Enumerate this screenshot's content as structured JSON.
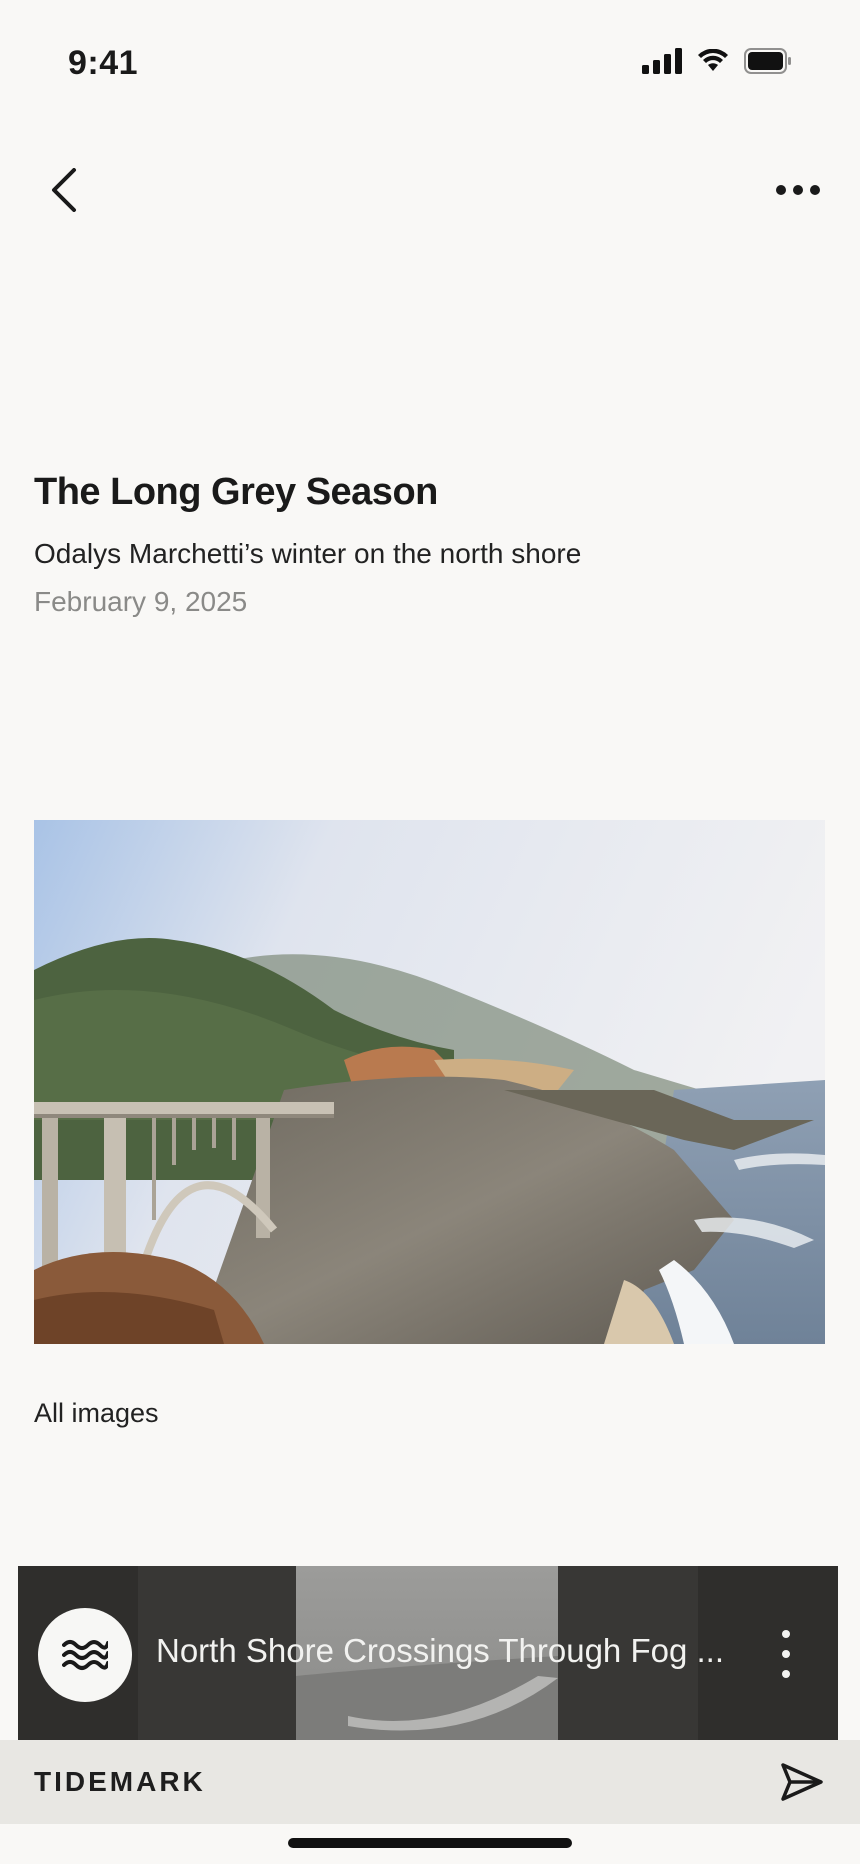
{
  "status_bar": {
    "time": "9:41",
    "icons": [
      "cellular-signal-icon",
      "wifi-icon",
      "battery-icon"
    ]
  },
  "nav": {
    "back_icon": "chevron-left-icon",
    "more_icon": "ellipsis-icon"
  },
  "article": {
    "title": "The Long Grey Season",
    "subtitle": "Odalys Marchetti’s winter on the north shore",
    "date": "February 9, 2025"
  },
  "gallery": {
    "all_images_label": "All images"
  },
  "player": {
    "logo_icon": "waves-icon",
    "title": "North Shore Crossings Through Fog ...",
    "menu_icon": "vertical-ellipsis-icon"
  },
  "footer": {
    "brand": "TIDEMARK",
    "send_icon": "send-icon"
  },
  "colors": {
    "background": "#f9f8f6",
    "footer_background": "#e8e7e3",
    "player_background": "#2f2e2c",
    "date_text": "#8a8a88"
  }
}
